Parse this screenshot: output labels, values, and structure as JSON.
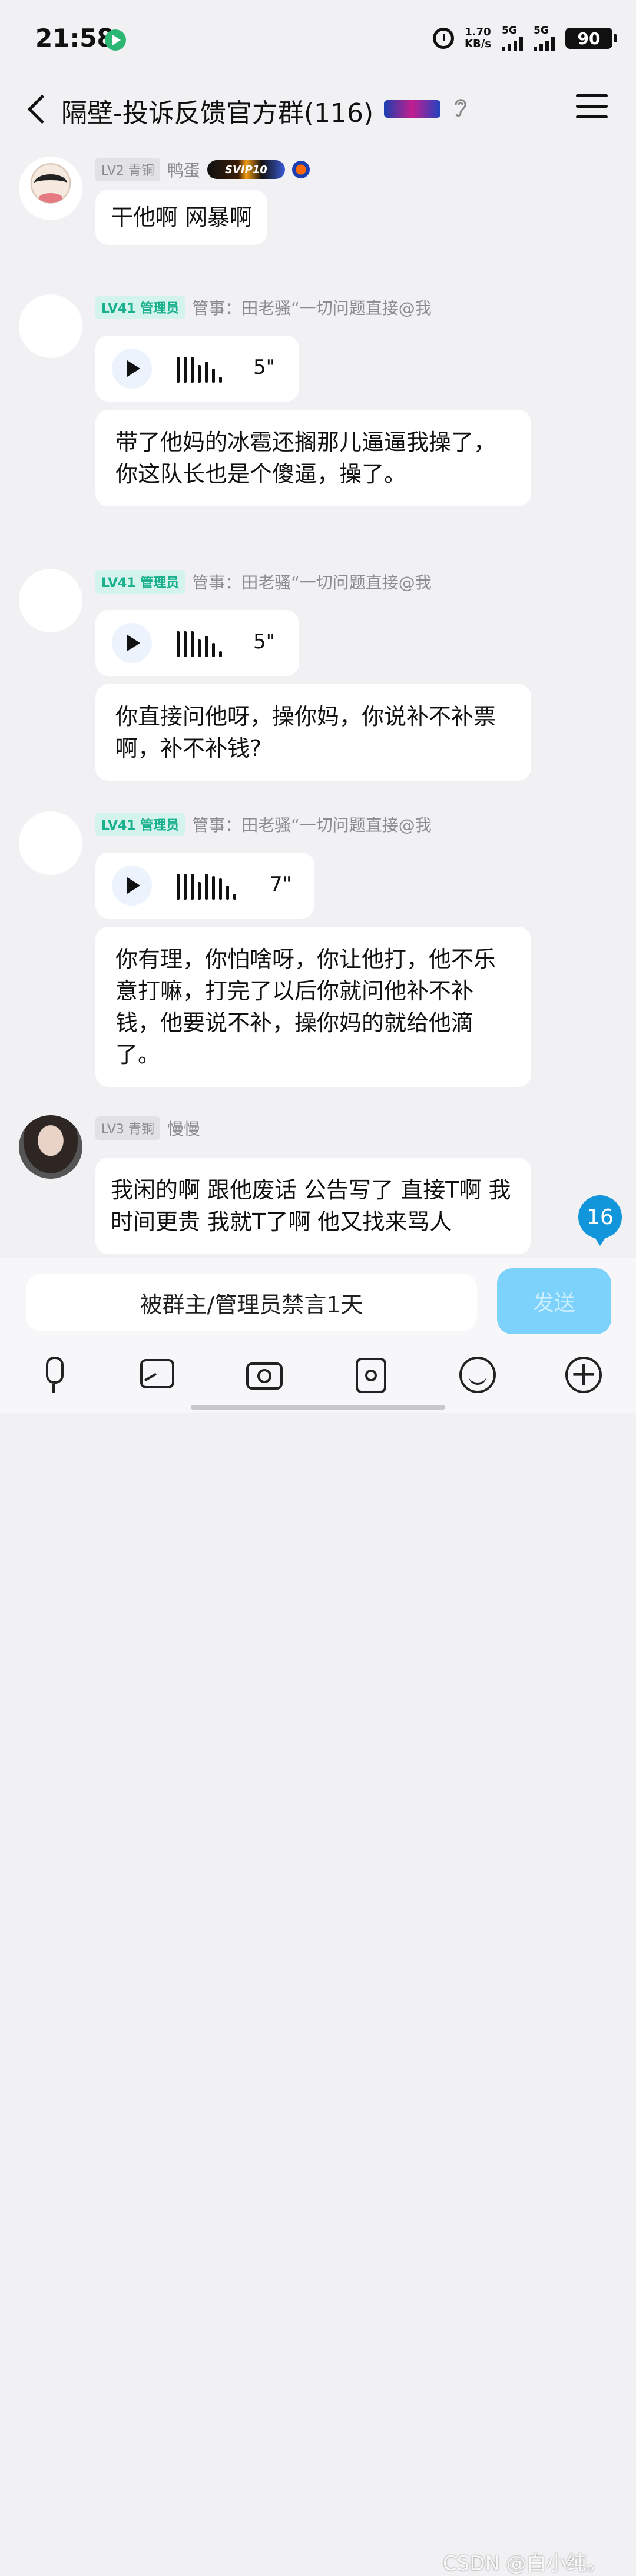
{
  "status_bar": {
    "time": "21:58",
    "net_speed_value": "1.70",
    "net_speed_unit": "KB/s",
    "sim1": "5G",
    "sim2": "5G",
    "battery": "90"
  },
  "header": {
    "title": "隔壁-投诉反馈官方群(116)"
  },
  "messages": [
    {
      "level": "LV2 青铜",
      "name": "鸭蛋",
      "badge": "SVIP10",
      "text": "干他啊   网暴啊"
    },
    {
      "level": "LV41 管理员",
      "name": "管事：田老骚“一切问题直接@我",
      "voice_duration": "5\"",
      "text": "带了他妈的冰雹还搁那儿逼逼我操了，你这队长也是个傻逼，操了。"
    },
    {
      "level": "LV41 管理员",
      "name": "管事：田老骚“一切问题直接@我",
      "voice_duration": "5\"",
      "text": "你直接问他呀，操你妈，你说补不补票啊，补不补钱?"
    },
    {
      "level": "LV41 管理员",
      "name": "管事：田老骚“一切问题直接@我",
      "voice_duration": "7\"",
      "text": "你有理，你怕啥呀，你让他打，他不乐意打嘛，打完了以后你就问他补不补钱，他要说不补，操你妈的就给他滴了。"
    },
    {
      "level": "LV3 青铜",
      "name": "慢慢",
      "text": "我闲的啊 跟他废话  公告写了 直接T啊  我时间更贵 我就T了啊 他又找来骂人"
    }
  ],
  "unread_count": "16",
  "input": {
    "muted_text": "被群主/管理员禁言1天",
    "send_label": "发送"
  },
  "watermark": "CSDN @白小纯。",
  "colors": {
    "background": "#f1f1f3",
    "admin_tag": "#19b08e",
    "send_button": "#7cd2fb",
    "unread_badge": "#1296db"
  }
}
